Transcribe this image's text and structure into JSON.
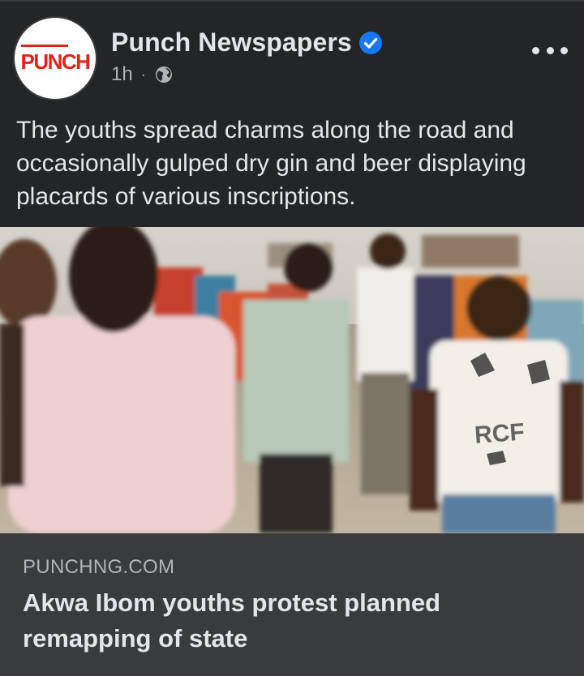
{
  "post": {
    "page_name": "Punch Newspapers",
    "avatar_logo_text": "PUNCH",
    "timestamp": "1h",
    "separator": "·",
    "audience_icon": "globe-icon",
    "verified_icon": "verified-badge-icon",
    "more_icon": "more-options-icon",
    "caption": "The youths spread charms along the road and occasionally gulped dry gin and beer displaying placards of various inscriptions."
  },
  "link_preview": {
    "domain": "PUNCHNG.COM",
    "headline": "Akwa Ibom youths protest planned remapping of state"
  },
  "colors": {
    "background": "#242526",
    "link_box": "#3a3b3c",
    "primary_text": "#e4e6eb",
    "secondary_text": "#b0b3b8",
    "verified_blue": "#1877f2",
    "logo_red": "#e2231a"
  }
}
